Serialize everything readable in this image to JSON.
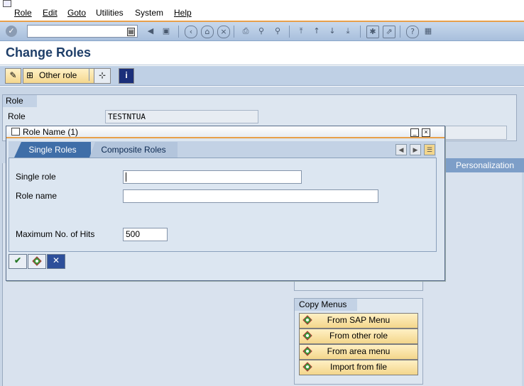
{
  "menu": {
    "items": [
      "Role",
      "Edit",
      "Goto",
      "Utilities",
      "System",
      "Help"
    ]
  },
  "toolbar": {
    "command_field_value": "",
    "icons": [
      "enter-icon",
      "back-icon",
      "save-icon",
      "prev-screen-icon",
      "exit-icon",
      "cancel-icon",
      "print-icon",
      "find-icon",
      "find-next-icon",
      "first-page-icon",
      "prev-page-icon",
      "next-page-icon",
      "last-page-icon",
      "new-session-icon",
      "shortcut-icon",
      "help-icon",
      "layout-icon"
    ]
  },
  "page": {
    "title": "Change Roles"
  },
  "app_toolbar": {
    "other_role_label": "Other role"
  },
  "role_section": {
    "group_title": "Role",
    "role_label": "Role",
    "role_value": "TESTNTUA",
    "personalization_tab": "Personalization"
  },
  "copy_menus": {
    "title": "Copy Menus",
    "buttons": [
      "From SAP Menu",
      "From other role",
      "From area menu",
      "Import from file"
    ]
  },
  "dialog": {
    "title": "Role Name (1)",
    "tabs": [
      "Single Roles",
      "Composite Roles"
    ],
    "fields": {
      "single_role_label": "Single role",
      "single_role_value": "",
      "role_name_label": "Role name",
      "role_name_value": "",
      "max_hits_label": "Maximum No. of Hits",
      "max_hits_value": "500"
    }
  },
  "colors": {
    "title_blue": "#1e3e68",
    "active_tab": "#3f6ea8",
    "accent_orange": "#e8a04a",
    "button_yellow": "#f3d68b"
  }
}
